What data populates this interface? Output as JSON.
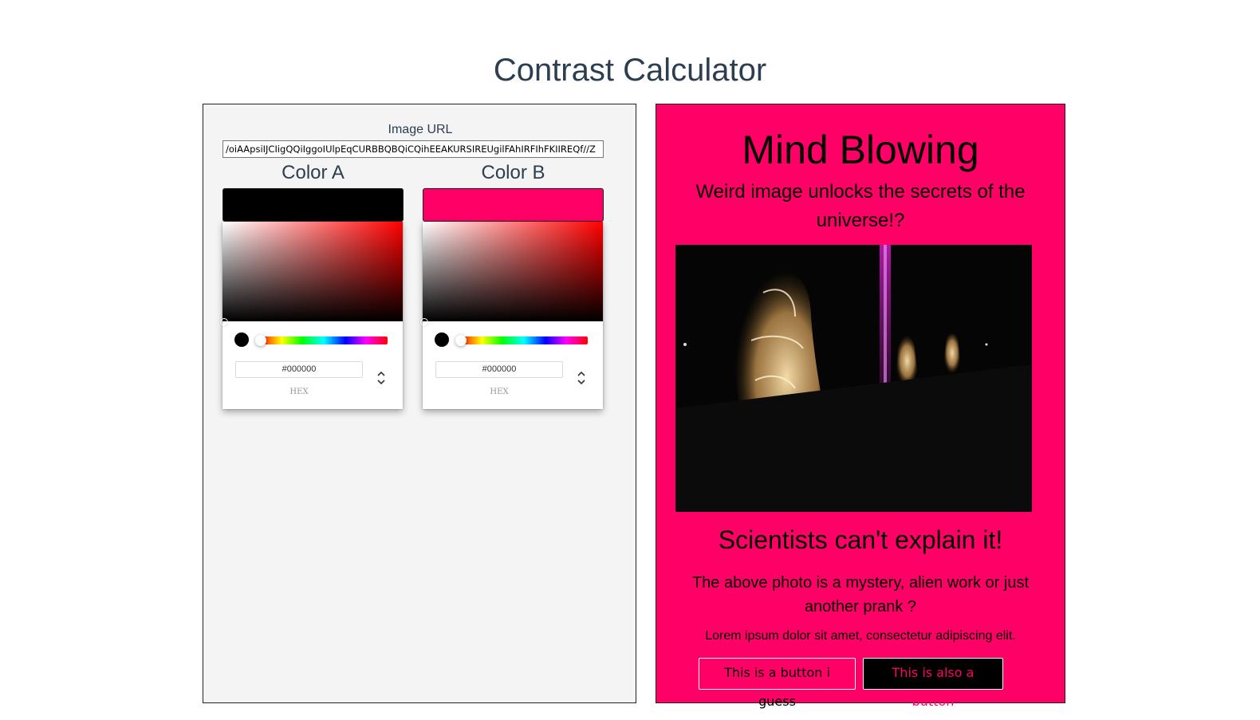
{
  "page": {
    "title": "Contrast Calculator"
  },
  "image_url": {
    "label": "Image URL",
    "value": "/oiAApsiIJCIigQQiIggoIUlpEqCURBBQBQiCQihEEAKURSIREUgilFAhIRFIhFKIIREQf//Z"
  },
  "color_a": {
    "heading": "Color A",
    "swatch_color": "#000000",
    "hex_value": "#000000",
    "hex_label": "HEX"
  },
  "color_b": {
    "heading": "Color B",
    "swatch_color": "#ff0066",
    "hex_value": "#000000",
    "hex_label": "HEX"
  },
  "preview": {
    "background": "#ff0066",
    "title": "Mind Blowing",
    "subtitle": "Weird image unlocks the secrets of the universe!?",
    "heading": "Scientists can't explain it!",
    "body": "The above photo is a mystery, alien work or just another prank ?",
    "lorem": "Lorem ipsum dolor sit amet, consectetur adipiscing elit.",
    "button_one": "This is a button i guess",
    "button_two": "This is also a button"
  }
}
